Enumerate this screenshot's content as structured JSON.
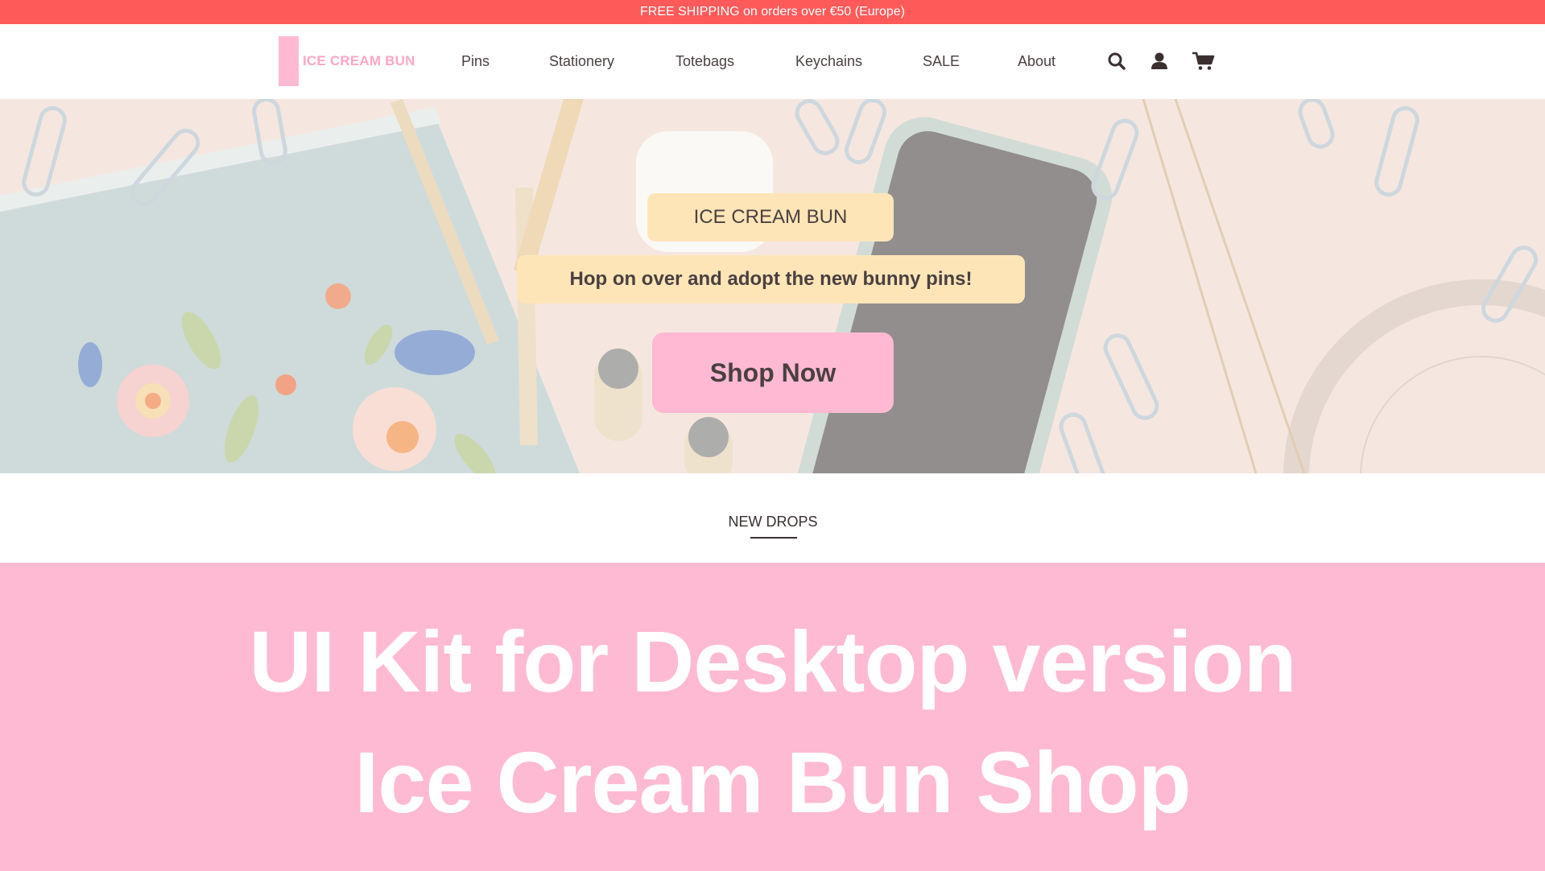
{
  "promo": {
    "text": "FREE SHIPPING on orders over €50 (Europe)"
  },
  "brand": {
    "name": "ICE CREAM BUN",
    "color_primary": "#ffb9d3",
    "color_logo_text": "#ffa6c6",
    "color_promo": "#fe5a59",
    "color_cream": "#fee5b8"
  },
  "nav": {
    "items": [
      {
        "label": "Pins"
      },
      {
        "label": "Stationery"
      },
      {
        "label": "Totebags"
      },
      {
        "label": "Keychains"
      },
      {
        "label": "SALE"
      },
      {
        "label": "About"
      }
    ],
    "icons": [
      "search-icon",
      "account-icon",
      "cart-icon"
    ]
  },
  "hero": {
    "title": "ICE CREAM BUN",
    "subtitle": "Hop on over and adopt the new bunny pins!",
    "cta": "Shop Now"
  },
  "section": {
    "tab": "NEW DROPS"
  },
  "banner": {
    "line1": "UI Kit for Desktop version",
    "line2": "Ice Cream Bun Shop"
  }
}
